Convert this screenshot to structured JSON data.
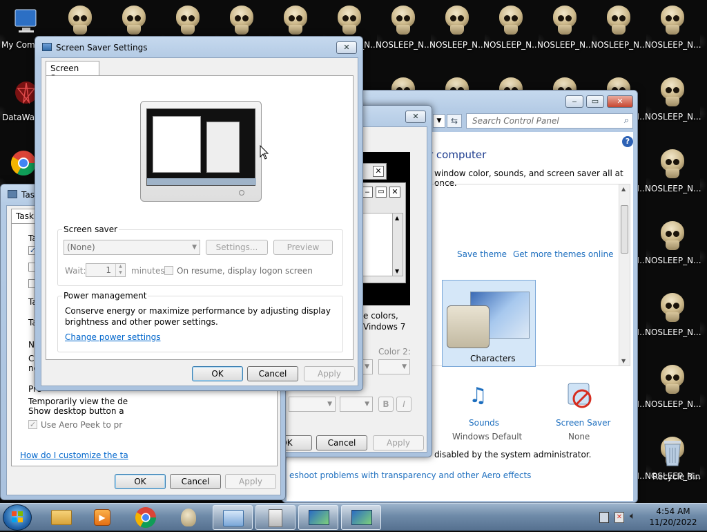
{
  "desktop": {
    "icons": [
      {
        "label": "My Comp"
      },
      {
        "label": "DataWag"
      },
      {
        "label": "Recycle Bin"
      }
    ],
    "skull_label": "NOSLEEP_N..."
  },
  "control_panel": {
    "search_placeholder": "Search Control Panel",
    "heading": "r computer",
    "subtext": "window color, sounds, and screen saver all at once.",
    "save_theme": "Save theme",
    "get_more_themes": "Get more themes online",
    "theme_name": "Characters",
    "sounds_label": "Sounds",
    "sounds_value": "Windows Default",
    "screensaver_label": "Screen Saver",
    "screensaver_value": "None",
    "disabled_text": "disabled by the system administrator.",
    "troubleshoot": "eshoot problems with transparency and other Aero effects"
  },
  "color_dialog": {
    "text1": "e colors,",
    "text2": "Vindows 7",
    "color2_label": "Color 2:",
    "bold": "B",
    "italic": "I",
    "ok": "OK",
    "cancel": "Cancel",
    "apply": "Apply"
  },
  "taskbar_props": {
    "title": "Task",
    "tab": "Taskb",
    "ta1": "Ta",
    "ta2": "Ta",
    "ta3": "Ta",
    "no": "No",
    "cu": "Cu",
    "no2": "no",
    "pre": "Pre",
    "peek_text1": "Temporarily view the de",
    "peek_text2": "Show desktop button a",
    "aero_peek": "Use Aero Peek to pr",
    "help_link": "How do I customize the ta",
    "ok": "OK",
    "cancel": "Cancel",
    "apply": "Apply"
  },
  "screen_saver_dialog": {
    "title": "Screen Saver Settings",
    "tab": "Screen Saver",
    "group_screensaver": "Screen saver",
    "selected": "(None)",
    "settings_btn": "Settings...",
    "preview_btn": "Preview",
    "wait_label": "Wait:",
    "wait_value": "1",
    "minutes": "minutes",
    "resume_label": "On resume, display logon screen",
    "group_power": "Power management",
    "power_text1": "Conserve energy or maximize performance by adjusting display",
    "power_text2": "brightness and other power settings.",
    "power_link": "Change power settings",
    "ok": "OK",
    "cancel": "Cancel",
    "apply": "Apply"
  },
  "tray": {
    "time": "4:54 AM",
    "date": "11/20/2022"
  }
}
